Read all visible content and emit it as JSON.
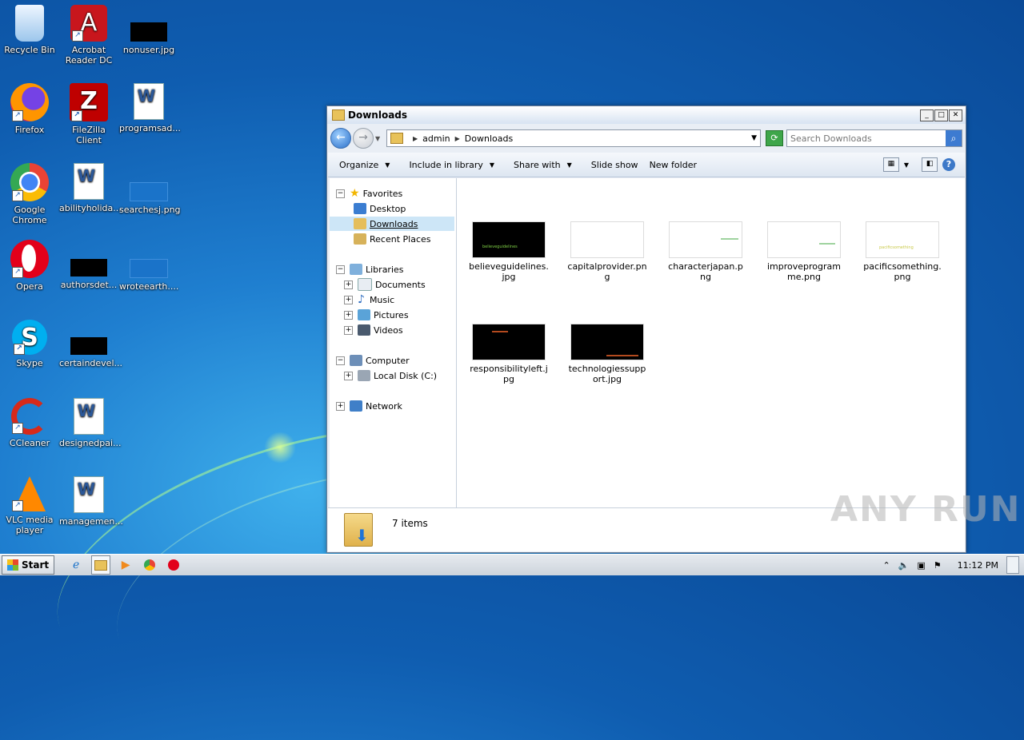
{
  "desktop": {
    "icons": [
      {
        "label": "Recycle Bin"
      },
      {
        "label": "Acrobat Reader DC"
      },
      {
        "label": "nonuser.jpg"
      },
      {
        "label": "Firefox"
      },
      {
        "label": "FileZilla Client"
      },
      {
        "label": "programsad..."
      },
      {
        "label": "Google Chrome"
      },
      {
        "label": "abilityholida..."
      },
      {
        "label": "searchesj.png"
      },
      {
        "label": "Opera"
      },
      {
        "label": "authorsdet..."
      },
      {
        "label": "wroteearth...."
      },
      {
        "label": "Skype"
      },
      {
        "label": "certaindevel..."
      },
      {
        "label": "CCleaner"
      },
      {
        "label": "designedpai..."
      },
      {
        "label": "VLC media player"
      },
      {
        "label": "managemen..."
      }
    ]
  },
  "window": {
    "title": "Downloads",
    "address": {
      "crumbs": [
        "admin",
        "Downloads"
      ]
    },
    "search_placeholder": "Search Downloads",
    "toolbar": {
      "organize": "Organize",
      "include": "Include in library",
      "share": "Share with",
      "slideshow": "Slide show",
      "newfolder": "New folder"
    },
    "nav": {
      "favorites": "Favorites",
      "desktop": "Desktop",
      "downloads": "Downloads",
      "recent": "Recent Places",
      "libraries": "Libraries",
      "documents": "Documents",
      "music": "Music",
      "pictures": "Pictures",
      "videos": "Videos",
      "computer": "Computer",
      "localdisk": "Local Disk (C:)",
      "network": "Network"
    },
    "files": [
      {
        "name": "believeguidelines.jpg",
        "thumb_text": "believeguidelines"
      },
      {
        "name": "capitalprovider.png",
        "thumb_text": ""
      },
      {
        "name": "characterjapan.png",
        "thumb_text": ""
      },
      {
        "name": "improveprogramme.png",
        "thumb_text": ""
      },
      {
        "name": "pacificsomething.png",
        "thumb_text": "pacificsomething"
      },
      {
        "name": "responsibilityleft.jpg",
        "thumb_text": ""
      },
      {
        "name": "technologiessupport.jpg",
        "thumb_text": ""
      }
    ],
    "status": {
      "count": "7 items"
    }
  },
  "taskbar": {
    "start": "Start",
    "clock": "11:12 PM"
  },
  "watermark": "ANY RUN"
}
